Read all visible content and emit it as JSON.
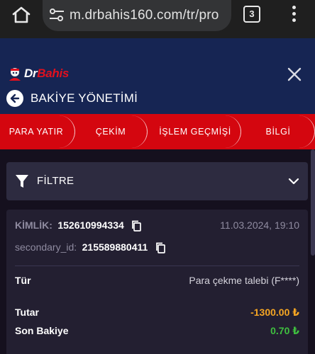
{
  "browser": {
    "url": "m.drbahis160.com/tr/pro",
    "tab_count": "3"
  },
  "header": {
    "logo_dr": "Dr",
    "logo_bahis": "Bahis",
    "title": "BAKİYE YÖNETİMİ"
  },
  "tabs": [
    {
      "label": "PARA YATIR"
    },
    {
      "label": "ÇEKİM"
    },
    {
      "label": "İŞLEM GEÇMİŞİ"
    },
    {
      "label": "BİLGİ"
    }
  ],
  "filter": {
    "label": "FİLTRE"
  },
  "transaction": {
    "id_label": "KİMLİK:",
    "id_value": "152610994334",
    "date": "11.03.2024, 19:10",
    "secondary_label": "secondary_id:",
    "secondary_value": "215589880411",
    "type_label": "Tür",
    "type_value": "Para çekme talebi (F****)",
    "amount_label": "Tutar",
    "amount_value": "-1300.00 ₺",
    "balance_label": "Son Bakiye",
    "balance_value": "0.70 ₺"
  },
  "colors": {
    "header_bg": "#162553",
    "tabbar_bg": "#d4060f",
    "amount": "#f6a623",
    "balance": "#3fbf3f"
  }
}
